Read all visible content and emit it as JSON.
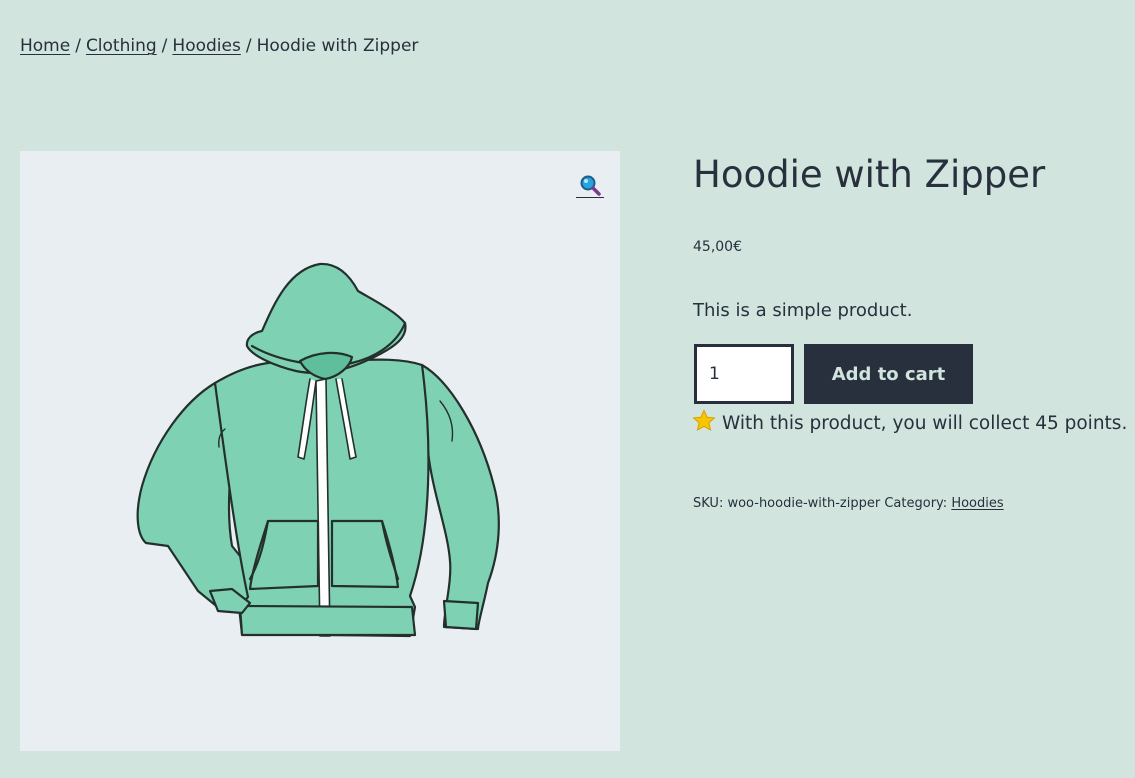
{
  "breadcrumb": {
    "items": [
      "Home",
      "Clothing",
      "Hoodies"
    ],
    "separator": "/",
    "current": "Hoodie with Zipper"
  },
  "gallery": {
    "zoom_icon": "magnifier-icon",
    "image": "hoodie-illustration"
  },
  "product": {
    "title": "Hoodie with Zipper",
    "price": "45,00€",
    "short_description": "This is a simple product.",
    "quantity": "1",
    "add_to_cart_label": "Add to cart",
    "points_icon": "star-icon",
    "points_text": "With this product, you will collect 45 points.",
    "sku_label": "SKU:",
    "sku_value": "woo-hoodie-with-zipper",
    "category_label": "Category:",
    "category_value": "Hoodies"
  },
  "colors": {
    "background": "#d1e4dd",
    "text": "#28303d",
    "gallery_bg": "#e9eef2",
    "hoodie_fill": "#7fd1b4",
    "button_bg": "#28303d",
    "button_text": "#d1e4dd"
  }
}
